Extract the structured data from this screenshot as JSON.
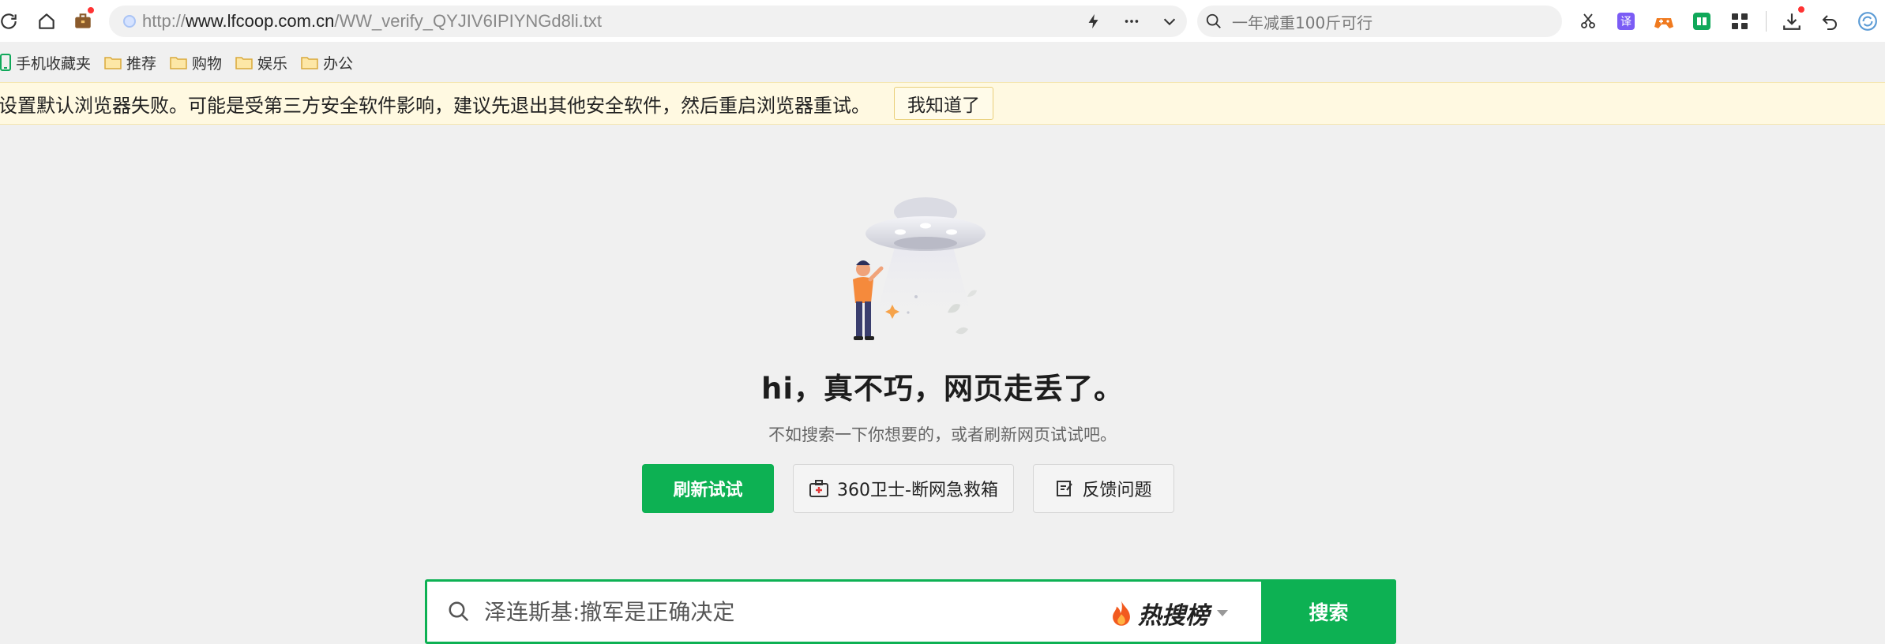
{
  "toolbar": {
    "url_prefix": "http://",
    "url_host": "www.lfcoop.com.cn",
    "url_path": "/WW_verify_QYJIV6IPIYNGd8li.txt",
    "search_placeholder": "一年减重100斤可行"
  },
  "bookmarks": [
    {
      "label": "手机收藏夹",
      "icon": "mobile-icon"
    },
    {
      "label": "推荐",
      "icon": "folder-icon"
    },
    {
      "label": "购物",
      "icon": "folder-icon"
    },
    {
      "label": "娱乐",
      "icon": "folder-icon"
    },
    {
      "label": "办公",
      "icon": "folder-icon"
    }
  ],
  "notice": {
    "message": "设置默认浏览器失败。可能是受第三方安全软件影响，建议先退出其他安全软件，然后重启浏览器重试。",
    "button": "我知道了"
  },
  "error_page": {
    "title": "hi，真不巧，网页走丢了。",
    "subtitle": "不如搜索一下你想要的，或者刷新网页试试吧。",
    "refresh_button": "刷新试试",
    "guard_button": "360卫士-断网急救箱",
    "feedback_button": "反馈问题"
  },
  "hot_search": {
    "placeholder": "泽连斯基:撤军是正确决定",
    "brand": "热搜榜",
    "submit": "搜索"
  },
  "colors": {
    "accent_green": "#0db153",
    "notice_bg": "#fff9e1",
    "page_bg": "#f0f0f0"
  }
}
